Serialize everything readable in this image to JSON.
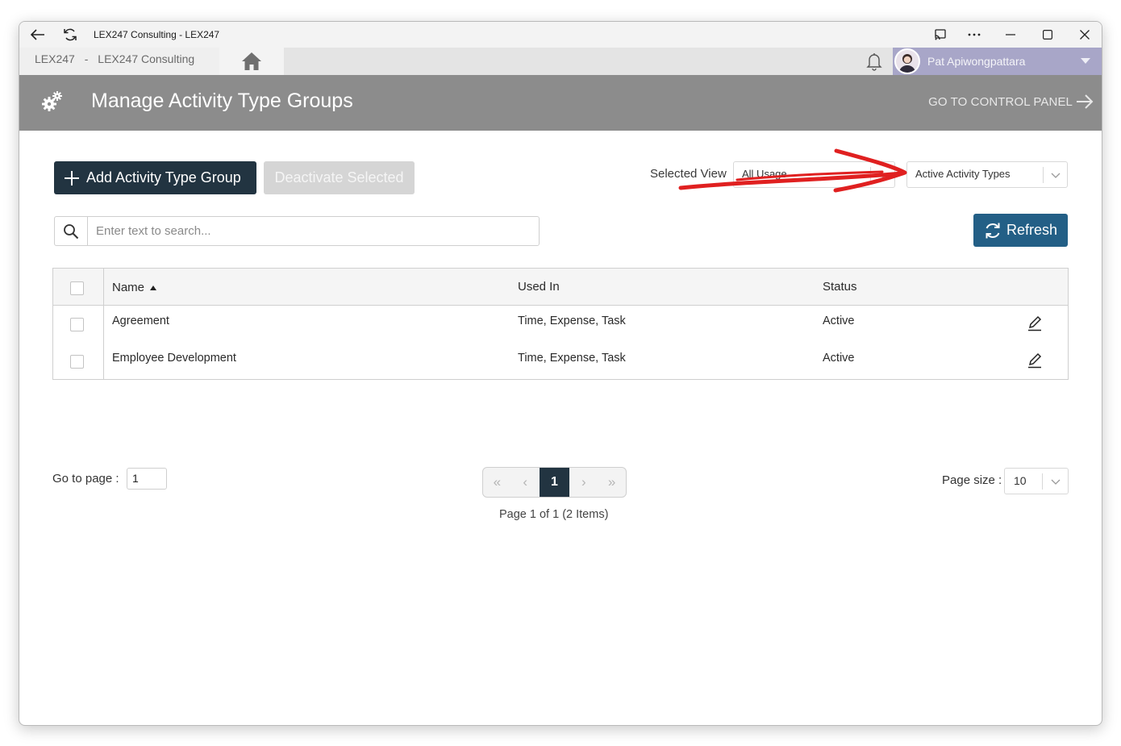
{
  "window": {
    "title": "LEX247 Consulting - LEX247"
  },
  "topbar": {
    "crumb_org": "LEX247",
    "crumb_sep": "-",
    "crumb_company": "LEX247 Consulting",
    "user_name": "Pat Apiwongpattara"
  },
  "header": {
    "title": "Manage Activity Type Groups",
    "control_panel_label": "GO TO CONTROL PANEL"
  },
  "toolbar": {
    "add_label": "Add Activity Type Group",
    "deactivate_label": "Deactivate Selected",
    "selected_view_label": "Selected View",
    "usage_filter_value": "All Usage",
    "status_filter_value": "Active Activity Types",
    "search_placeholder": "Enter text to search...",
    "refresh_label": "Refresh"
  },
  "grid": {
    "columns": [
      "Name",
      "Used In",
      "Status"
    ],
    "sort": {
      "column": "Name",
      "direction": "ascending"
    },
    "rows": [
      {
        "name": "Agreement",
        "used_in": "Time, Expense, Task",
        "status": "Active"
      },
      {
        "name": "Employee Development",
        "used_in": "Time, Expense, Task",
        "status": "Active"
      }
    ]
  },
  "pagination": {
    "goto_label": "Go to page :",
    "goto_value": "1",
    "current_page": "1",
    "info": "Page 1 of 1 (2 Items)",
    "page_size_label": "Page size :",
    "page_size_value": "10"
  },
  "colors": {
    "primary_dark": "#223441",
    "refresh_blue": "#235f86",
    "header_gray": "#8c8c8c",
    "user_purple": "#a8a6c8",
    "annotation_red": "#e02020"
  },
  "icons": [
    "back-arrow-icon",
    "refresh-page-icon",
    "cast-icon",
    "more-icon",
    "minimize-icon",
    "maximize-icon",
    "close-icon",
    "home-icon",
    "bell-icon",
    "avatar",
    "gears-icon",
    "arrow-right-icon",
    "plus-icon",
    "search-icon",
    "sync-icon",
    "sort-asc-icon",
    "edit-pencil-icon"
  ]
}
